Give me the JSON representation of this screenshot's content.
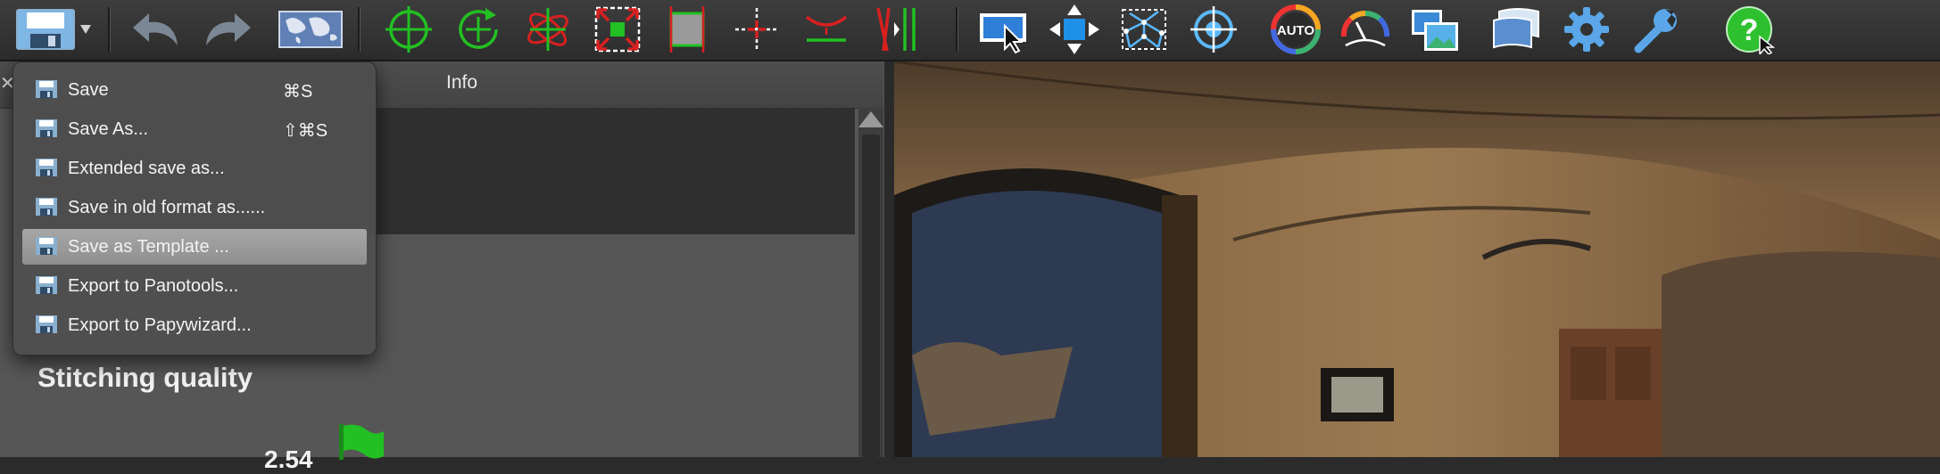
{
  "toolbar": {
    "buttons": [
      {
        "name": "save-menu-button",
        "icon": "disk-icon"
      },
      {
        "name": "undo-button",
        "icon": "undo-arrow-icon"
      },
      {
        "name": "redo-button",
        "icon": "redo-arrow-icon"
      },
      {
        "name": "world-map-button",
        "icon": "world-map-icon"
      },
      {
        "name": "add-control-point-button",
        "icon": "crosshair-target-icon"
      },
      {
        "name": "rotate-control-point-button",
        "icon": "rotate-crosshair-icon"
      },
      {
        "name": "orbit-button",
        "icon": "orbit-icon"
      },
      {
        "name": "fit-panorama-button",
        "icon": "expand-corners-icon"
      },
      {
        "name": "crop-button",
        "icon": "crop-square-icon"
      },
      {
        "name": "center-button",
        "icon": "center-cross-icon"
      },
      {
        "name": "horizon-button",
        "icon": "horizon-curve-icon"
      },
      {
        "name": "vertical-lines-button",
        "icon": "vertical-lines-icon"
      },
      {
        "name": "select-button",
        "icon": "select-pointer-icon"
      },
      {
        "name": "move-button",
        "icon": "move-arrows-icon"
      },
      {
        "name": "mesh-button",
        "icon": "mesh-grid-icon"
      },
      {
        "name": "target-button",
        "icon": "target-icon"
      },
      {
        "name": "auto-button",
        "icon": "auto-color-wheel-icon",
        "label": "AUTO"
      },
      {
        "name": "gauge-button",
        "icon": "gauge-icon"
      },
      {
        "name": "images-button",
        "icon": "images-icon"
      },
      {
        "name": "panorama-output-button",
        "icon": "panorama-output-icon"
      },
      {
        "name": "settings-button",
        "icon": "gear-icon"
      },
      {
        "name": "tools-button",
        "icon": "wrench-icon"
      },
      {
        "name": "help-button",
        "icon": "help-question-icon",
        "label": "?"
      }
    ]
  },
  "left_panel": {
    "close_label": "✕",
    "tab_label": "Info",
    "section_title": "Stitching quality",
    "quality_value": "2.54"
  },
  "file_menu": {
    "items": [
      {
        "label": "Save",
        "shortcut": "⌘S"
      },
      {
        "label": "Save As...",
        "shortcut": "⇧⌘S"
      },
      {
        "label": "Extended save as...",
        "shortcut": ""
      },
      {
        "label": "Save in old format as......",
        "shortcut": ""
      },
      {
        "label": "Save as Template ...",
        "shortcut": "",
        "highlighted": true
      },
      {
        "label": "Export to Panotools...",
        "shortcut": ""
      },
      {
        "label": "Export to Papywizard...",
        "shortcut": ""
      }
    ]
  },
  "colors": {
    "accent_green": "#22c022",
    "accent_red": "#d82020",
    "accent_blue": "#1e90e8",
    "menu_highlight": "#9b9b9b"
  }
}
